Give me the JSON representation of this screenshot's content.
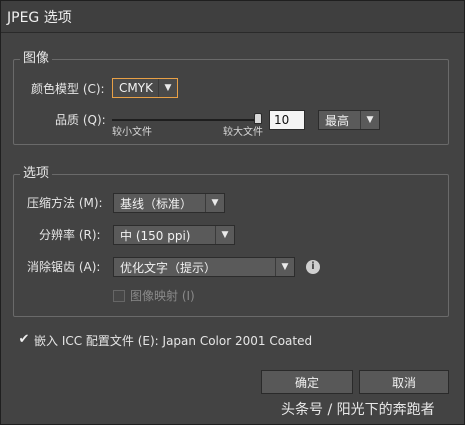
{
  "window": {
    "title": "JPEG 选项"
  },
  "image_group": {
    "title": "图像",
    "color_model_label": "颜色模型 (C):",
    "color_model_value": "CMYK",
    "quality_label": "品质 (Q):",
    "quality_value": "10",
    "quality_preset": "最高",
    "slider_min_label": "较小文件",
    "slider_max_label": "较大文件",
    "slider_fraction": 1.0
  },
  "options_group": {
    "title": "选项",
    "compression_label": "压缩方法 (M):",
    "compression_value": "基线（标准）",
    "resolution_label": "分辨率 (R):",
    "resolution_value": "中 (150 ppi)",
    "antialias_label": "消除锯齿 (A):",
    "antialias_value": "优化文字（提示）",
    "image_map_label": "图像映射 (I)",
    "image_map_checked": false
  },
  "embed_icc": {
    "checked": true,
    "label": "嵌入 ICC 配置文件 (E): Japan Color 2001 Coated"
  },
  "buttons": {
    "ok": "确定",
    "cancel": "取消"
  },
  "watermark": "头条号 / 阳光下的奔跑者",
  "colors": {
    "dialog_bg": "#434343",
    "focus_outline": "#e8a046"
  }
}
